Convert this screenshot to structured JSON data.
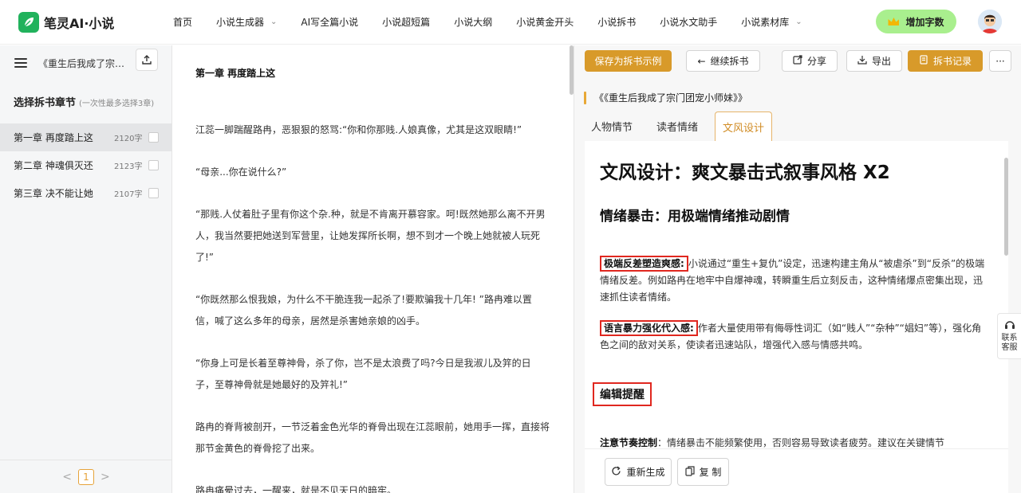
{
  "header": {
    "logo_text": "笔灵AI·小说",
    "nav": [
      {
        "label": "首页",
        "has_dropdown": false
      },
      {
        "label": "小说生成器",
        "has_dropdown": true
      },
      {
        "label": "AI写全篇小说",
        "has_dropdown": false
      },
      {
        "label": "小说超短篇",
        "has_dropdown": false
      },
      {
        "label": "小说大纲",
        "has_dropdown": false
      },
      {
        "label": "小说黄金开头",
        "has_dropdown": false
      },
      {
        "label": "小说拆书",
        "has_dropdown": false
      },
      {
        "label": "小说水文助手",
        "has_dropdown": false
      },
      {
        "label": "小说素材库",
        "has_dropdown": true
      }
    ],
    "add_words_label": "增加字数"
  },
  "sidebar": {
    "book_name": "《重生后我成了宗门团宠小师妹》",
    "section_title": "选择拆书章节",
    "section_hint": "(一次性最多选择3章)",
    "chapters": [
      {
        "title": "第一章 再度踏上这",
        "words": "2120字"
      },
      {
        "title": "第二章 神魂俱灭还",
        "words": "2123字"
      },
      {
        "title": "第三章 决不能让她",
        "words": "2107字"
      }
    ],
    "pager": {
      "current": "1",
      "prev": "<",
      "next": ">"
    }
  },
  "reader": {
    "chapter_title": "第一章 再度踏上这",
    "paragraphs": [
      "江蕊一脚踹醒路冉，恶狠狠的怒骂:“你和你那贱.人娘真像，尤其是这双眼睛!”",
      "“母亲...你在说什么?”",
      "“那贱.人仗着肚子里有你这个杂.种，就是不肯离开慕容家。呵!既然她那么离不开男人，我当然要把她送到军营里，让她发挥所长啊，想不到才一个晚上她就被人玩死了!”",
      "“你既然那么恨我娘，为什么不干脆连我一起杀了!要欺骗我十几年! ”路冉难以置信，喊了这么多年的母亲，居然是杀害她亲娘的凶手。",
      "“你身上可是长着至尊神骨，杀了你，岂不是太浪费了吗?今日是我淑儿及笄的日子，至尊神骨就是她最好的及笄礼!”",
      "路冉的脊背被剖开，一节泛着金色光华的脊骨出现在江蕊眼前，她用手一挥，直接将那节金黄色的脊骨挖了出来。",
      "路冉痛晕过去，一醒来，就是不见天日的暗牢。"
    ]
  },
  "panel": {
    "buttons": {
      "save_example": "保存为拆书示例",
      "continue": "继续拆书",
      "share": "分享",
      "export": "导出",
      "records": "拆书记录",
      "more": "···"
    },
    "book_title": "《《重生后我成了宗门团宠小师妹》》",
    "tabs": [
      "人物情节",
      "读者情绪",
      "文风设计"
    ],
    "active_tab": 2,
    "content": {
      "h1": "文风设计：爽文暴击式叙事风格 X2",
      "h2": "情绪暴击：用极端情绪推动剧情",
      "item1_label": "极端反差塑造爽感:",
      "item1_text": "小说通过“重生+复仇”设定，迅速构建主角从“被虐杀”到“反杀”的极端情绪反差。例如路冉在地牢中自爆神魂，转瞬重生后立刻反击，这种情绪爆点密集出现，迅速抓住读者情绪。",
      "item2_label": "语言暴力强化代入感:",
      "item2_text": "作者大量使用带有侮辱性词汇（如“贱人”“杂种”“娼妇”等），强化角色之间的敌对关系，使读者迅速站队，增强代入感与情感共鸣。",
      "edit_title": "编辑提醒",
      "note_label": "注意节奏控制",
      "note_text": "：情绪暴击不能频繁使用，否则容易导致读者疲劳。建议在关键情节"
    },
    "footer": {
      "regenerate": "重新生成",
      "copy": "复 制"
    }
  },
  "service": {
    "line1": "联系",
    "line2": "客服"
  },
  "colors": {
    "brand": "#21b25c",
    "accent": "#d89a2a",
    "highlight": "#e0271f",
    "add_words_bg": "#a9ef8e"
  }
}
